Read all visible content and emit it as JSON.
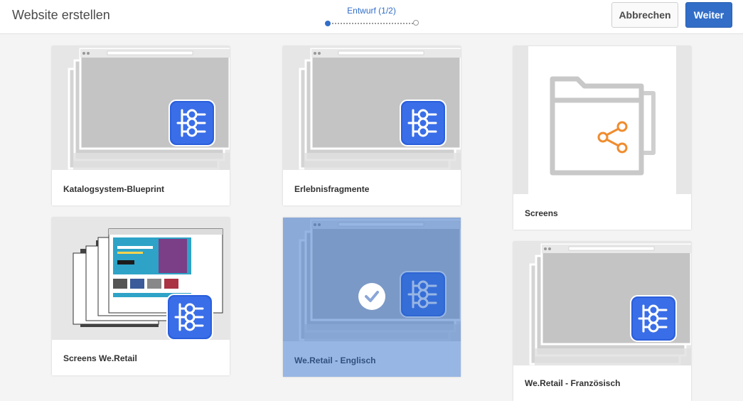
{
  "header": {
    "title": "Website erstellen",
    "wizard_step": "Entwurf (1/2)",
    "cancel_label": "Abbrechen",
    "next_label": "Weiter"
  },
  "templates": [
    {
      "label": "Katalogsystem-Blueprint",
      "icon": "browser-stack-blueprint-icon"
    },
    {
      "label": "Erlebnisfragmente",
      "icon": "browser-stack-blueprint-icon"
    },
    {
      "label": "Screens",
      "icon": "folder-share-icon"
    },
    {
      "label": "Screens We.Retail",
      "icon": "website-screens-blueprint-icon"
    },
    {
      "label": "We.Retail - Englisch",
      "icon": "browser-stack-blueprint-icon",
      "selected": true
    },
    {
      "label": "We.Retail - Französisch",
      "icon": "browser-stack-blueprint-icon"
    }
  ],
  "colors": {
    "accent": "#326ec8",
    "icon_blue": "#2b5fdc",
    "share_orange": "#f08c2e"
  }
}
